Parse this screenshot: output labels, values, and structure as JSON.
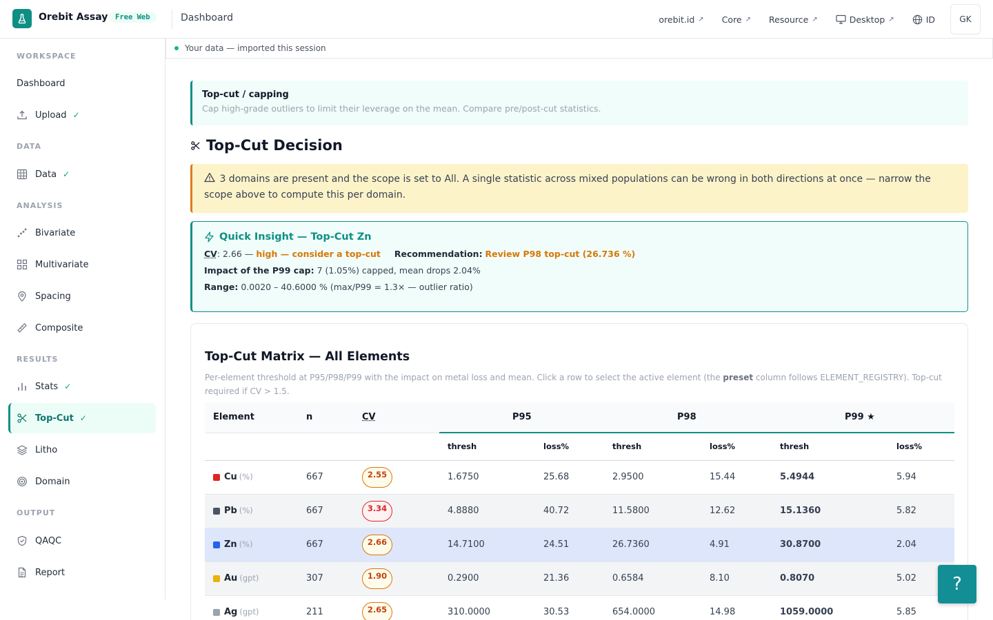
{
  "header": {
    "brand": "Orebit Assay",
    "badge": "Free Web",
    "page_title": "Dashboard",
    "links": [
      {
        "label": "orebit.id",
        "icon": "external-arrow"
      },
      {
        "label": "Core",
        "icon": "external-arrow"
      },
      {
        "label": "Resource",
        "icon": "external-arrow"
      },
      {
        "label": "Desktop",
        "icon": "external-arrow"
      }
    ],
    "language": "ID",
    "avatar": "GK",
    "arrow_glyph": "↗"
  },
  "sidebar": {
    "sections": {
      "workspace": "WORKSPACE",
      "data": "DATA",
      "analysis": "ANALYSIS",
      "results": "RESULTS",
      "output": "OUTPUT"
    },
    "items": {
      "dashboard": {
        "label": "Dashboard"
      },
      "upload": {
        "label": "Upload",
        "done": true
      },
      "data": {
        "label": "Data",
        "done": true
      },
      "bivariate": {
        "label": "Bivariate"
      },
      "multivariate": {
        "label": "Multivariate"
      },
      "spacing": {
        "label": "Spacing"
      },
      "composite": {
        "label": "Composite"
      },
      "stats": {
        "label": "Stats",
        "done": true
      },
      "topcut": {
        "label": "Top-Cut",
        "done": true,
        "active": true
      },
      "litho": {
        "label": "Litho"
      },
      "domain": {
        "label": "Domain"
      },
      "qaqc": {
        "label": "QAQC"
      },
      "report": {
        "label": "Report"
      }
    },
    "check_glyph": "✓"
  },
  "status_strip": "Your data — imported this session",
  "info": {
    "title": "Top-cut / capping",
    "subtitle": "Cap high-grade outliers to limit their leverage on the mean. Compare pre/post-cut statistics."
  },
  "section_title": "Top-Cut Decision",
  "warning": "3 domains are present and the scope is set to All. A single statistic across mixed populations can be wrong in both directions at once — narrow the scope above to compute this per domain.",
  "quick_insight": {
    "title": "Quick Insight — Top-Cut Zn",
    "cv_label": "CV",
    "cv_value": ": 2.66 —",
    "cv_verdict": "high — consider a top-cut",
    "rec_label": "Recommendation:",
    "rec_value": "Review P98 top-cut (26.736 %)",
    "impact_label": "Impact of the P99 cap:",
    "impact_value": "7 (1.05%) capped, mean drops 2.04%",
    "range_label": "Range:",
    "range_value": "0.0020 – 40.6000 % (max/P99 = 1.3× — outlier ratio)"
  },
  "matrix": {
    "title": "Top-Cut Matrix — All Elements",
    "desc_pre": "Per-element threshold at P95/P98/P99 with the impact on metal loss and mean. Click a row to select the active element (the ",
    "desc_bold": "preset",
    "desc_post": " column follows ELEMENT_REGISTRY). Top-cut required if CV > 1.5.",
    "headers": {
      "element": "Element",
      "n": "n",
      "cv": "CV",
      "p95": "P95",
      "p98": "P98",
      "p99": "P99 ★",
      "thresh": "thresh",
      "loss": "loss%"
    },
    "rows": [
      {
        "element": "Cu",
        "unit": "(%)",
        "color": "#dc2626",
        "n": "667",
        "cv": "2.55",
        "cv_level": "high",
        "p95_thresh": "1.6750",
        "p95_loss": "25.68",
        "p98_thresh": "2.9500",
        "p98_loss": "15.44",
        "p99_thresh": "5.4944",
        "p99_loss": "5.94"
      },
      {
        "element": "Pb",
        "unit": "(%)",
        "color": "#4b5563",
        "n": "667",
        "cv": "3.34",
        "cv_level": "extreme",
        "p95_thresh": "4.8880",
        "p95_loss": "40.72",
        "p98_thresh": "11.5800",
        "p98_loss": "12.62",
        "p99_thresh": "15.1360",
        "p99_loss": "5.82"
      },
      {
        "element": "Zn",
        "unit": "(%)",
        "color": "#2563eb",
        "n": "667",
        "cv": "2.66",
        "cv_level": "high",
        "p95_thresh": "14.7100",
        "p95_loss": "24.51",
        "p98_thresh": "26.7360",
        "p98_loss": "4.91",
        "p99_thresh": "30.8700",
        "p99_loss": "2.04"
      },
      {
        "element": "Au",
        "unit": "(gpt)",
        "color": "#eab308",
        "n": "307",
        "cv": "1.90",
        "cv_level": "high",
        "p95_thresh": "0.2900",
        "p95_loss": "21.36",
        "p98_thresh": "0.6584",
        "p98_loss": "8.10",
        "p99_thresh": "0.8070",
        "p99_loss": "5.02"
      },
      {
        "element": "Ag",
        "unit": "(gpt)",
        "color": "#9ca3af",
        "n": "211",
        "cv": "2.65",
        "cv_level": "high",
        "p95_thresh": "310.0000",
        "p95_loss": "30.53",
        "p98_thresh": "654.0000",
        "p98_loss": "14.98",
        "p99_thresh": "1059.0000",
        "p99_loss": "5.85"
      }
    ],
    "selected_element": "Zn"
  },
  "help_button": "?"
}
